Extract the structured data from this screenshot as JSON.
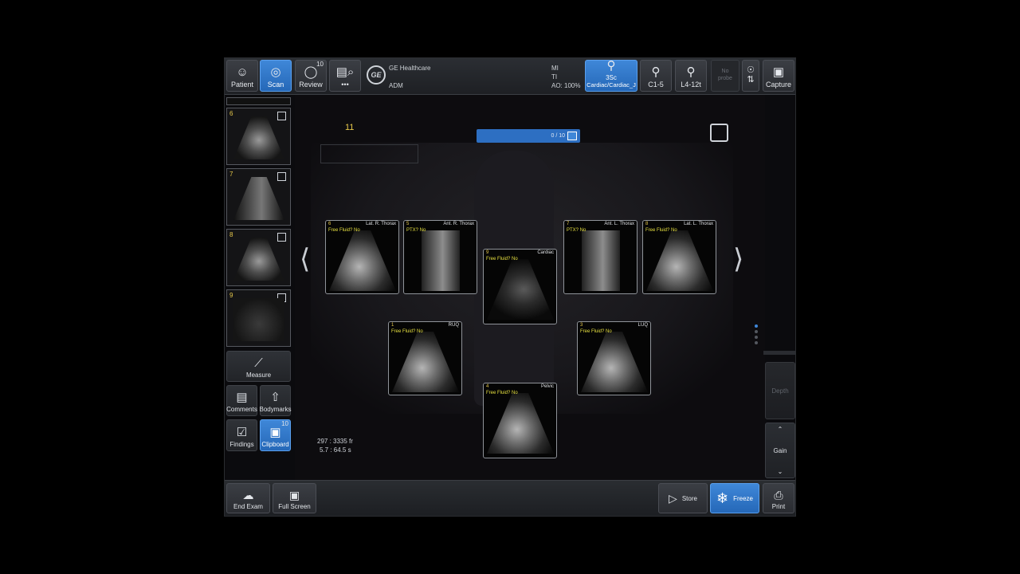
{
  "topbar": {
    "patient_label": "Patient",
    "scan_label": "Scan",
    "review_label": "Review",
    "review_badge": "10",
    "more_label": "•••",
    "brand": "GE Healthcare",
    "user": "ADM",
    "mi_label": "MI",
    "ti_label": "TI",
    "ao_label": "AO: 100%",
    "probes": [
      {
        "name": "3Sc",
        "preset": "Cardiac/Cardiac_J",
        "active": true
      },
      {
        "name": "C1-5",
        "preset": "",
        "active": false
      },
      {
        "name": "L4-12t",
        "preset": "",
        "active": false
      }
    ],
    "no_probe": "No probe",
    "capture_label": "Capture"
  },
  "sidebar": {
    "thumbs": [
      {
        "num": "6"
      },
      {
        "num": "7"
      },
      {
        "num": "8"
      },
      {
        "num": "9"
      }
    ],
    "measure_label": "Measure",
    "comments_label": "Comments",
    "bodymarks_label": "Bodymarks",
    "findings_label": "Findings",
    "clipboard_label": "Clipboard",
    "clipboard_badge": "10"
  },
  "main": {
    "counter": "11",
    "progress_text": "0 / 10",
    "cards": [
      {
        "num": "6",
        "label": "Lat. R. Thorax",
        "finding": "Free Fluid?   No"
      },
      {
        "num": "5",
        "label": "Ant. R. Thorax",
        "finding": "PTX?   No"
      },
      {
        "num": "9",
        "label": "Cardiac",
        "finding": "Free Fluid?   No"
      },
      {
        "num": "7",
        "label": "Ant. L. Thorax",
        "finding": "PTX?   No"
      },
      {
        "num": "8",
        "label": "Lat. L. Thorax",
        "finding": "Free Fluid?   No"
      },
      {
        "num": "1",
        "label": "RUQ",
        "finding": "Free Fluid?   No"
      },
      {
        "num": "3",
        "label": "LUQ",
        "finding": "Free Fluid?   No"
      },
      {
        "num": "4",
        "label": "Pelvic",
        "finding": "Free Fluid?   No"
      }
    ],
    "readout_line1": "297 : 3335 fr",
    "readout_line2": "5.7 : 64.5 s"
  },
  "rightpanel": {
    "depth_label": "Depth",
    "gain_label": "Gain"
  },
  "bottombar": {
    "end_exam_label": "End Exam",
    "full_screen_label": "Full Screen",
    "store_label": "Store",
    "freeze_label": "Freeze",
    "print_label": "Print"
  },
  "icons": {
    "patient": "person-icon",
    "scan": "probe-icon",
    "review": "eye-icon",
    "capture": "camera-icon",
    "freeze": "snowflake-icon"
  },
  "colors": {
    "accent": "#3f87d8",
    "label_yellow": "#e6c84a"
  }
}
